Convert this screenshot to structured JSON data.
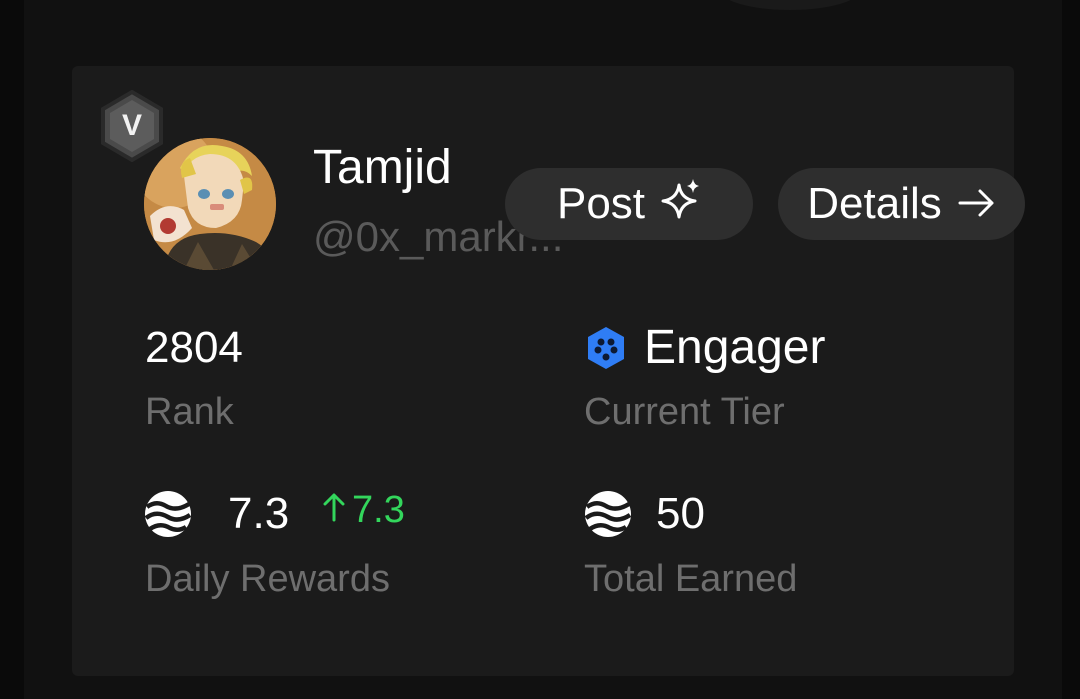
{
  "profile": {
    "level_badge": "V",
    "name": "Tamjid",
    "handle": "@0x_markr..."
  },
  "actions": {
    "post_label": "Post",
    "details_label": "Details"
  },
  "stats": {
    "rank": {
      "value": "2804",
      "label": "Rank"
    },
    "tier": {
      "value": "Engager",
      "label": "Current Tier"
    },
    "daily_rewards": {
      "value": "7.3",
      "delta": "7.3",
      "label": "Daily Rewards"
    },
    "total_earned": {
      "value": "50",
      "label": "Total Earned"
    }
  },
  "colors": {
    "background": "#0a0a0a",
    "card": "#1b1b1b",
    "pill": "#2e2e2e",
    "positive_delta": "#33d65c",
    "tier_blue": "#2f7df5",
    "muted_text": "#6e6e6e"
  },
  "icons": {
    "post": "sparkles-icon",
    "details": "arrow-right-icon",
    "tier": "hexagon-tier-icon",
    "reward_token": "token-wave-icon",
    "delta": "arrow-up-icon"
  }
}
